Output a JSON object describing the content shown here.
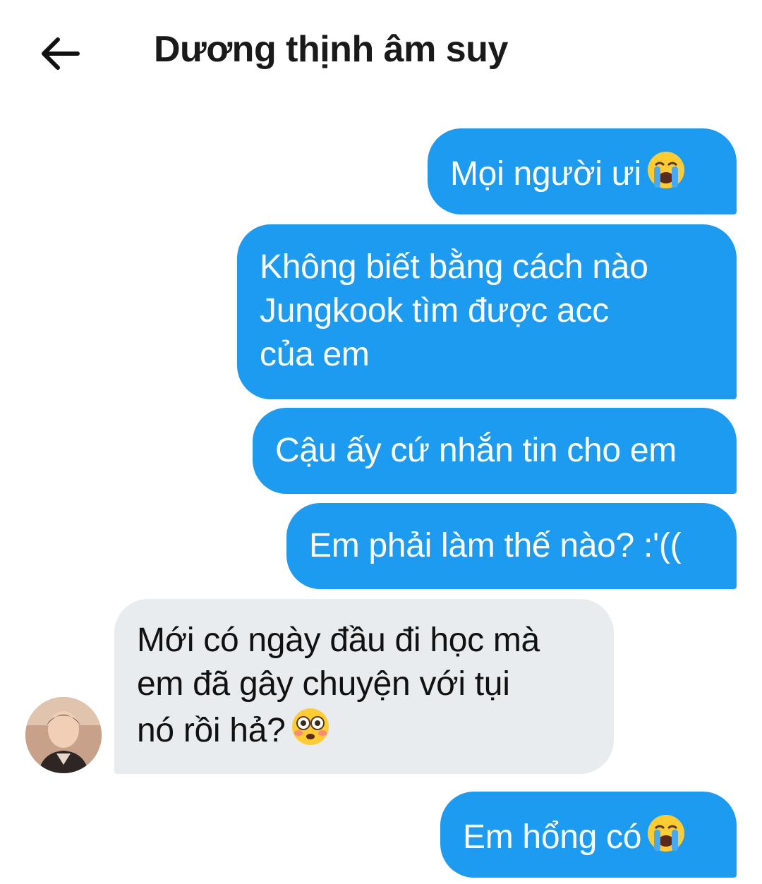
{
  "header": {
    "title": "Dương thịnh âm suy",
    "back_icon": "arrow-left-icon"
  },
  "messages": [
    {
      "side": "sent",
      "text": "Mọi người ưi",
      "emoji": "loudly-crying-face-icon"
    },
    {
      "side": "sent",
      "lines": [
        "Không biết bằng cách nào",
        "Jungkook tìm được acc",
        "của em"
      ]
    },
    {
      "side": "sent",
      "text": "Cậu ấy cứ nhắn tin cho em"
    },
    {
      "side": "sent",
      "text": "Em phải làm thế nào? :'(("
    },
    {
      "side": "received",
      "lines": [
        "Mới có ngày đầu đi học mà",
        "em đã gây chuyện với tụi",
        "nó rồi hả?"
      ],
      "emoji": "flushed-face-icon"
    },
    {
      "side": "sent",
      "text": "Em hổng có",
      "emoji": "loudly-crying-face-icon"
    }
  ],
  "colors": {
    "sent_bubble": "#1d9bf0",
    "received_bubble": "#e8ecef",
    "background": "#ffffff"
  }
}
